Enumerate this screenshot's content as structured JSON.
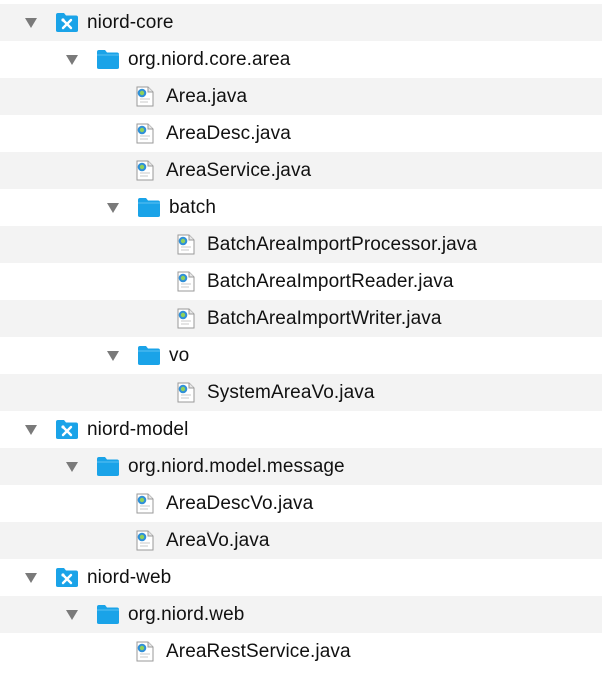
{
  "tree": {
    "rows": [
      {
        "label": "niord-core",
        "type": "project",
        "level": 0,
        "expanded": true
      },
      {
        "label": "org.niord.core.area",
        "type": "folder",
        "level": 1,
        "expanded": true
      },
      {
        "label": "Area.java",
        "type": "java",
        "level": 2
      },
      {
        "label": "AreaDesc.java",
        "type": "java",
        "level": 2
      },
      {
        "label": "AreaService.java",
        "type": "java",
        "level": 2
      },
      {
        "label": "batch",
        "type": "folder",
        "level": 2,
        "expanded": true
      },
      {
        "label": "BatchAreaImportProcessor.java",
        "type": "java",
        "level": 3
      },
      {
        "label": "BatchAreaImportReader.java",
        "type": "java",
        "level": 3
      },
      {
        "label": "BatchAreaImportWriter.java",
        "type": "java",
        "level": 3
      },
      {
        "label": "vo",
        "type": "folder",
        "level": 2,
        "expanded": true
      },
      {
        "label": "SystemAreaVo.java",
        "type": "java",
        "level": 3
      },
      {
        "label": "niord-model",
        "type": "project",
        "level": 0,
        "expanded": true
      },
      {
        "label": "org.niord.model.message",
        "type": "folder",
        "level": 1,
        "expanded": true
      },
      {
        "label": "AreaDescVo.java",
        "type": "java",
        "level": 2
      },
      {
        "label": "AreaVo.java",
        "type": "java",
        "level": 2
      },
      {
        "label": "niord-web",
        "type": "project",
        "level": 0,
        "expanded": true
      },
      {
        "label": "org.niord.web",
        "type": "folder",
        "level": 1,
        "expanded": true
      },
      {
        "label": "AreaRestService.java",
        "type": "java",
        "level": 2
      }
    ]
  },
  "colors": {
    "stripe": "#f3f3f3",
    "folder": "#1aa3e8",
    "project": "#1aa3e8",
    "disclosure": "#7a7a7a",
    "text": "#111111"
  },
  "icons": {
    "project": "project-icon",
    "folder": "folder-icon",
    "java": "java-file-icon",
    "disclosure": "disclosure-triangle-icon"
  }
}
